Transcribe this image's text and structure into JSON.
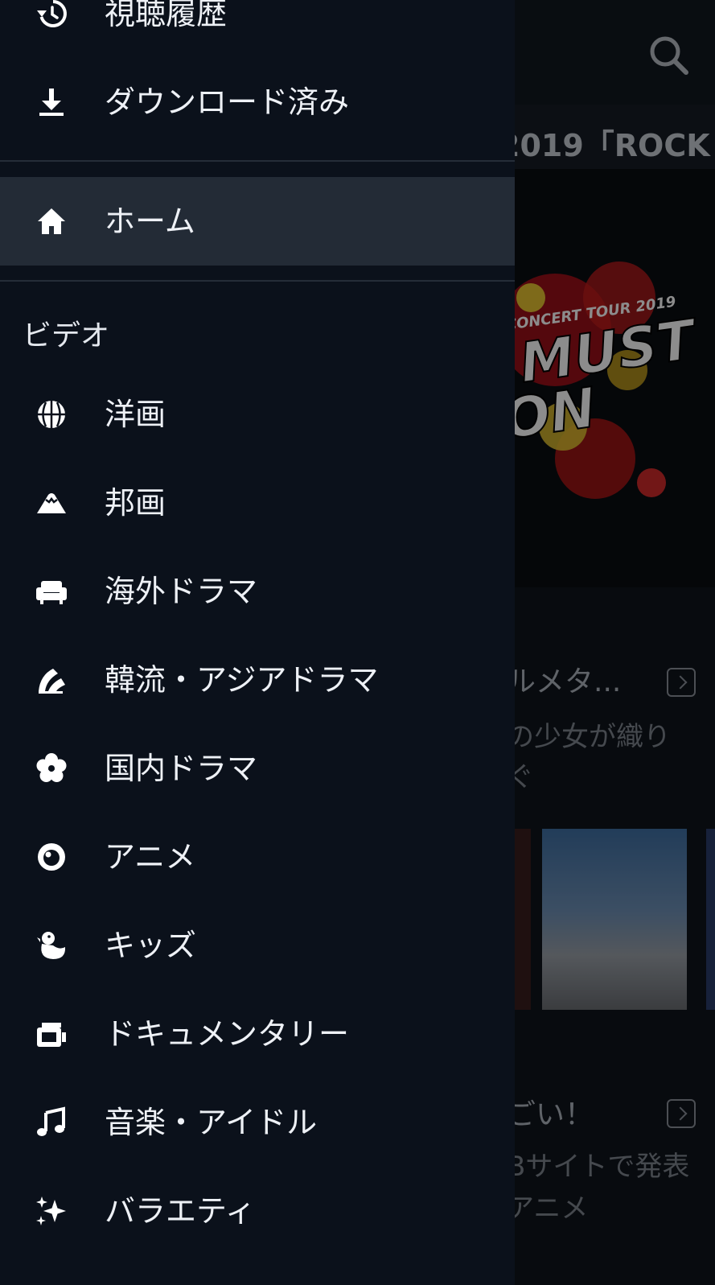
{
  "background": {
    "hero_title": "2019「ROCK ...",
    "hero_art_text_1": "CONCERT TOUR 2019",
    "hero_art_text_2": "MUST",
    "hero_art_text_3": "ON",
    "row1_title": "ルメタ...",
    "row1_sub1": "の少女が織り",
    "row1_sub2": "ぐ",
    "row2_title": "ごい！",
    "row2_sub1": "Bサイトで発表",
    "row2_sub2": "アニメ"
  },
  "drawer": {
    "top_items": [
      {
        "label": "視聴履歴",
        "icon": "history-icon"
      },
      {
        "label": "ダウンロード済み",
        "icon": "download-icon"
      }
    ],
    "home": {
      "label": "ホーム",
      "icon": "home-icon"
    },
    "section_video": "ビデオ",
    "categories": [
      {
        "label": "洋画",
        "icon": "globe-icon"
      },
      {
        "label": "邦画",
        "icon": "mountain-icon"
      },
      {
        "label": "海外ドラマ",
        "icon": "sofa-icon"
      },
      {
        "label": "韓流・アジアドラマ",
        "icon": "fan-icon"
      },
      {
        "label": "国内ドラマ",
        "icon": "flower-icon"
      },
      {
        "label": "アニメ",
        "icon": "anime-eye-icon"
      },
      {
        "label": "キッズ",
        "icon": "chick-icon"
      },
      {
        "label": "ドキュメンタリー",
        "icon": "camera-icon"
      },
      {
        "label": "音楽・アイドル",
        "icon": "music-note-icon"
      },
      {
        "label": "バラエティ",
        "icon": "sparkles-icon"
      }
    ]
  }
}
